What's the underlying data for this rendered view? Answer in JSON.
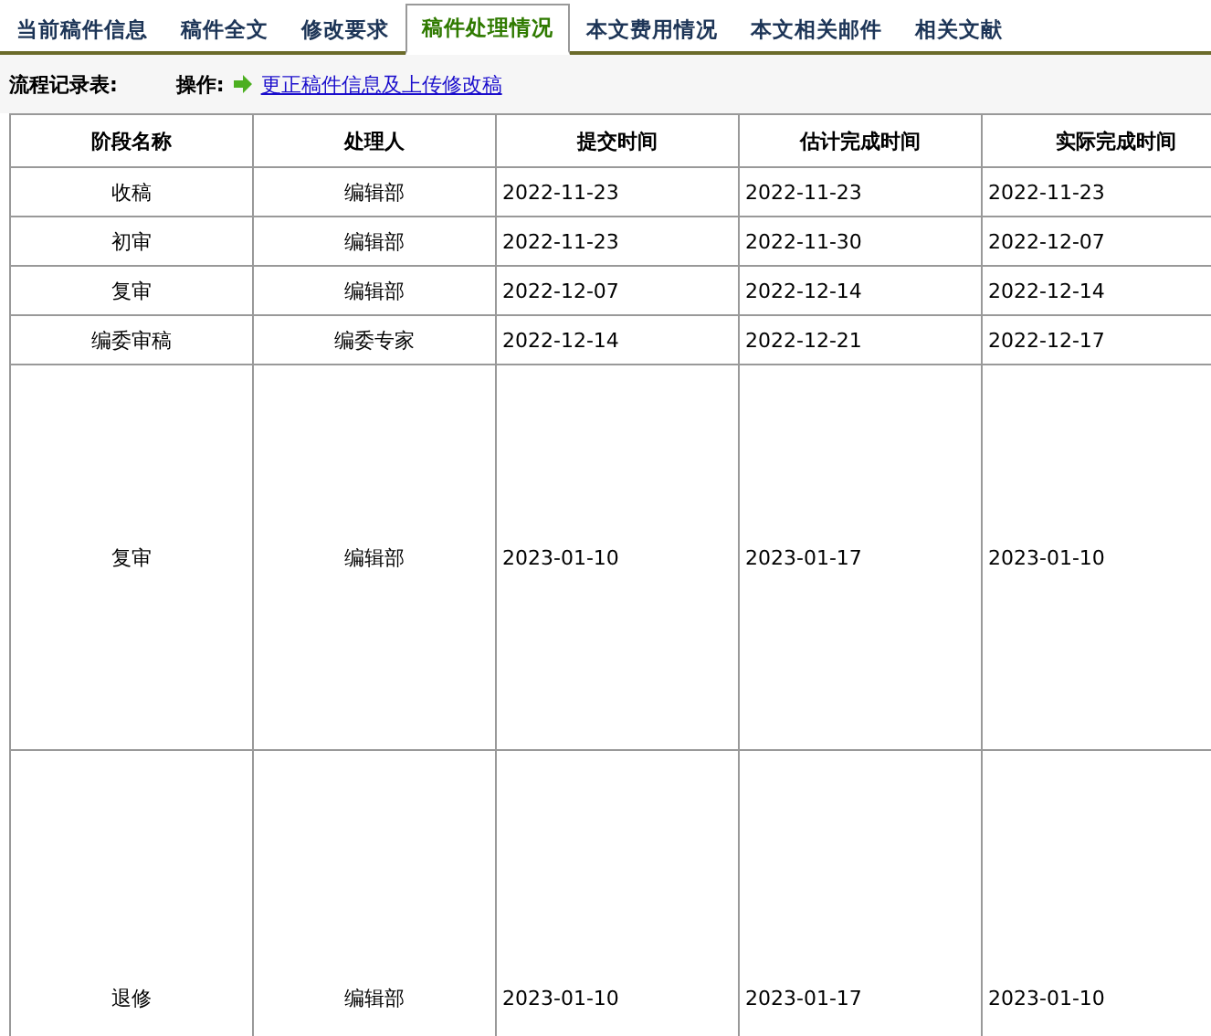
{
  "tabs": [
    {
      "label": "当前稿件信息",
      "selected": false
    },
    {
      "label": "稿件全文",
      "selected": false
    },
    {
      "label": "修改要求",
      "selected": false
    },
    {
      "label": "稿件处理情况",
      "selected": true
    },
    {
      "label": "本文费用情况",
      "selected": false
    },
    {
      "label": "本文相关邮件",
      "selected": false
    },
    {
      "label": "相关文献",
      "selected": false
    }
  ],
  "toolbar": {
    "title": "流程记录表:",
    "operation_label": "操作:",
    "link": "更正稿件信息及上传修改稿"
  },
  "table": {
    "columns": [
      "阶段名称",
      "处理人",
      "提交时间",
      "估计完成时间",
      "实际完成时间"
    ],
    "rows": [
      [
        "收稿",
        "编辑部",
        "2022-11-23",
        "2022-11-23",
        "2022-11-23"
      ],
      [
        "初审",
        "编辑部",
        "2022-11-23",
        "2022-11-30",
        "2022-12-07"
      ],
      [
        "复审",
        "编辑部",
        "2022-12-07",
        "2022-12-14",
        "2022-12-14"
      ],
      [
        "编委审稿",
        "编委专家",
        "2022-12-14",
        "2022-12-21",
        "2022-12-17"
      ],
      [
        "复审",
        "编辑部",
        "2023-01-10",
        "2023-01-17",
        "2023-01-10"
      ],
      [
        "退修",
        "编辑部",
        "2023-01-10",
        "2023-01-17",
        "2023-01-10"
      ]
    ]
  }
}
